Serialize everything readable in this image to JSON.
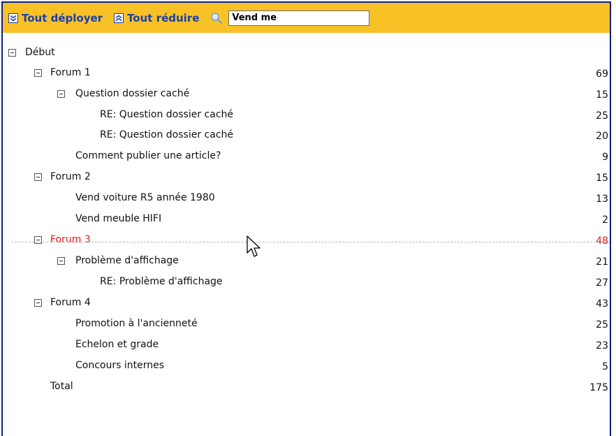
{
  "toolbar": {
    "expand_all": "Tout déployer",
    "collapse_all": "Tout réduire",
    "search_value": "Vend me"
  },
  "tree": {
    "root": "Début",
    "rows": [
      {
        "label": "Forum 1",
        "count": "69"
      },
      {
        "label": "Question dossier caché",
        "count": "15"
      },
      {
        "label": "RE: Question dossier caché",
        "count": "25"
      },
      {
        "label": "RE: Question dossier caché",
        "count": "20"
      },
      {
        "label": "Comment publier une article?",
        "count": "9"
      },
      {
        "label": "Forum 2",
        "count": "15"
      },
      {
        "label": "Vend voiture R5 année 1980",
        "count": "13"
      },
      {
        "label": "Vend meuble HIFI",
        "count": "2"
      },
      {
        "label": "Forum 3",
        "count": "48"
      },
      {
        "label": "Problème d'affichage",
        "count": "21"
      },
      {
        "label": "RE: Problème d'affichage",
        "count": "27"
      },
      {
        "label": "Forum 4",
        "count": "43"
      },
      {
        "label": "Promotion à l'ancienneté",
        "count": "25"
      },
      {
        "label": "Echelon et grade",
        "count": "23"
      },
      {
        "label": "Concours internes",
        "count": "5"
      }
    ],
    "total_label": "Total",
    "total_count": "175"
  },
  "colors": {
    "toolbar_bg": "#f8c126",
    "link": "#1b3fa8",
    "highlight": "#e0191e",
    "frame": "#0b1f86"
  },
  "icons": [
    "expand-all-icon",
    "collapse-all-icon",
    "search-icon",
    "mouse-cursor-icon"
  ]
}
